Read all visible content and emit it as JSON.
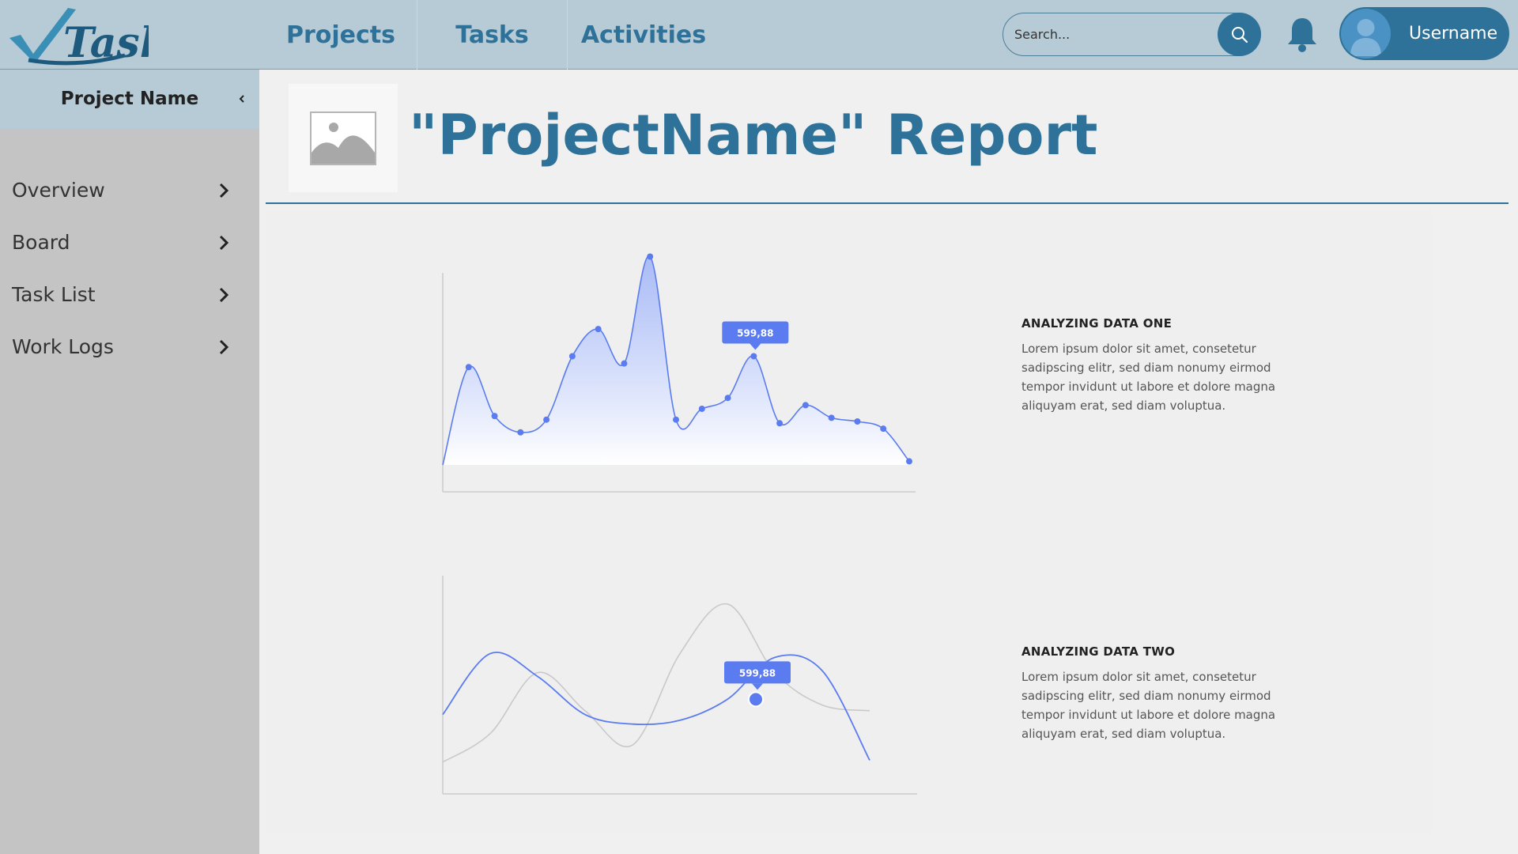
{
  "app": {
    "logo_text": "Tasky"
  },
  "nav": {
    "tabs": [
      {
        "label": "Projects"
      },
      {
        "label": "Tasks"
      },
      {
        "label": "Activities"
      }
    ]
  },
  "search": {
    "placeholder": "Search..."
  },
  "user": {
    "name": "Username"
  },
  "sidebar": {
    "title": "Project Name",
    "items": [
      {
        "label": "Overview"
      },
      {
        "label": "Board"
      },
      {
        "label": "Task List"
      },
      {
        "label": "Work Logs"
      }
    ]
  },
  "page": {
    "title": "\"ProjectName\" Report"
  },
  "blocks": [
    {
      "title": "ANALYZING DATA ONE",
      "body": "Lorem ipsum dolor sit amet, consetetur sadipscing elitr, sed diam nonumy eirmod tempor invidunt ut labore et dolore magna aliquyam erat, sed diam voluptua."
    },
    {
      "title": "ANALYZING DATA TWO",
      "body": "Lorem ipsum dolor sit amet, consetetur sadipscing elitr, sed diam nonumy eirmod tempor invidunt ut labore et dolore magna aliquyam erat, sed diam voluptua."
    }
  ],
  "colors": {
    "accent": "#2f7299",
    "topbar": "#b7cbd6",
    "sidebar": "#c4c4c4",
    "series": "#5b7cf0",
    "series_secondary": "#c9c9c9"
  },
  "icons": {
    "search": "search-icon",
    "bell": "bell-icon",
    "avatar": "user-avatar-icon",
    "chevron": "chevron-right-icon",
    "collapse": "chevron-left-icon",
    "image": "image-placeholder-icon"
  },
  "chart_data": [
    {
      "type": "area",
      "x": [
        0,
        1,
        2,
        3,
        4,
        5,
        6,
        7,
        8,
        9,
        10,
        11,
        12,
        13,
        14,
        15,
        16,
        17,
        18,
        19
      ],
      "series": [
        {
          "values": [
            0,
            54,
            27,
            18,
            25,
            60,
            75,
            56,
            115,
            25,
            31,
            37,
            60,
            23,
            33,
            26,
            24,
            20,
            2
          ]
        }
      ],
      "x_values": [
        0,
        1,
        2,
        3,
        4,
        5,
        6,
        7,
        8,
        9,
        10,
        11,
        12,
        13,
        14,
        15,
        16,
        17,
        18
      ],
      "ylim": [
        0,
        120
      ],
      "tooltip": {
        "index": 12,
        "label": "599,88"
      }
    },
    {
      "type": "line",
      "x": [
        0,
        1,
        2,
        3,
        4,
        5,
        6,
        7,
        8,
        9,
        10
      ],
      "series": [
        {
          "values": [
            40,
            72,
            60,
            40,
            35,
            37,
            48,
            70,
            63,
            16
          ]
        },
        {
          "values": [
            15,
            30,
            62,
            42,
            24,
            72,
            98,
            62,
            45,
            42
          ]
        }
      ],
      "ylim": [
        0,
        110
      ],
      "tooltip": {
        "series": 0,
        "x": 6.6,
        "value": 48,
        "label": "599,88"
      }
    }
  ]
}
